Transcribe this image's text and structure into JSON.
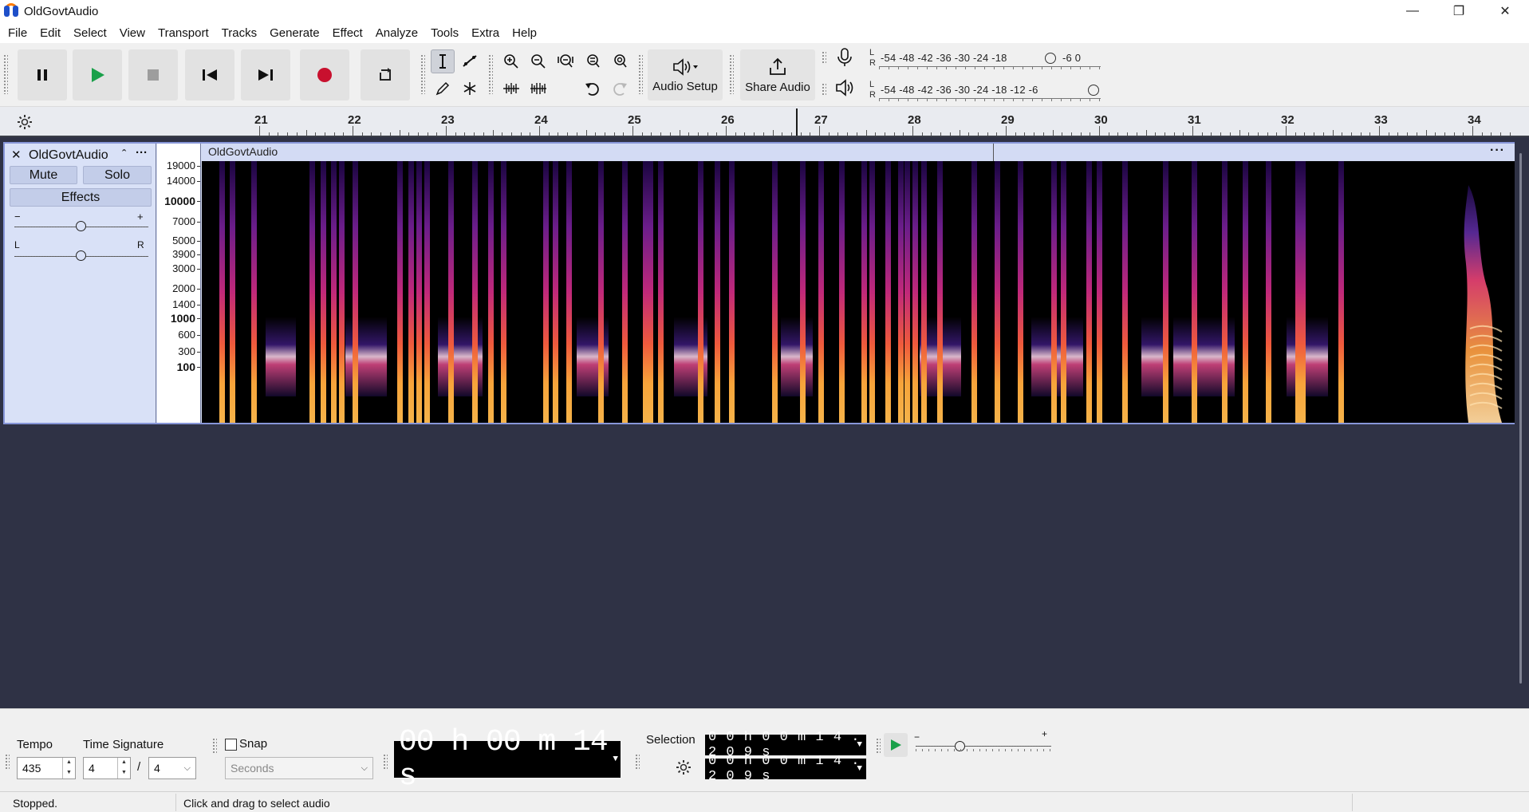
{
  "window": {
    "title": "OldGovtAudio",
    "minimize_glyph": "—",
    "maximize_glyph": "❐",
    "close_glyph": "✕"
  },
  "menu": [
    "File",
    "Edit",
    "Select",
    "View",
    "Transport",
    "Tracks",
    "Generate",
    "Effect",
    "Analyze",
    "Tools",
    "Extra",
    "Help"
  ],
  "toolbar": {
    "transport_icons": [
      "pause-icon",
      "play-icon",
      "stop-icon",
      "skip-to-start-icon",
      "skip-to-end-icon",
      "record-icon",
      "loop-icon"
    ],
    "audio_setup_label": "Audio Setup",
    "share_audio_label": "Share Audio",
    "record_meter": {
      "channels": "L\nR",
      "scale": "-54  -48  -42  -36  -30  -24  -18",
      "end": "-6    0"
    },
    "playback_meter": {
      "channels": "L\nR",
      "scale": "-54  -48  -42  -36  -30  -24  -18  -12   -6"
    }
  },
  "ruler": {
    "labels": [
      "21",
      "22",
      "23",
      "24",
      "25",
      "26",
      "27",
      "28",
      "29",
      "30",
      "31",
      "32",
      "33",
      "34"
    ]
  },
  "track": {
    "name": "OldGovtAudio",
    "close_glyph": "✕",
    "collapse_glyph": "ˆ",
    "menu_glyph": "···",
    "mute_label": "Mute",
    "solo_label": "Solo",
    "effects_label": "Effects",
    "gain_minus": "−",
    "gain_plus": "+",
    "pan_left": "L",
    "pan_right": "R",
    "gain_level": 0.5,
    "pan_level": 0.5,
    "clip_name": "OldGovtAudio",
    "clip_menu_glyph": "···",
    "freq_labels": [
      "19000",
      "14000",
      "10000",
      "7000",
      "5000",
      "3900",
      "3000",
      "2000",
      "1400",
      "1000",
      "600",
      "300",
      "100"
    ],
    "freq_bold": [
      "10000",
      "1000",
      "100"
    ]
  },
  "bottom": {
    "tempo_label": "Tempo",
    "tempo_value": "435",
    "time_sig_label": "Time Signature",
    "time_sig_num": "4",
    "time_sig_slash": "/",
    "time_sig_den": "4",
    "snap_label": "Snap",
    "snap_checked": false,
    "snap_unit": "Seconds",
    "time_display": "00 h 00 m 14 s",
    "selection_label": "Selection",
    "selection_start": "0 0 h 0 0 m 1 4 . 2 0 9 s",
    "selection_end": "0 0 h 0 0 m 1 4 . 2 0 9 s",
    "play_at_speed_minus": "−",
    "play_at_speed_plus": "+",
    "play_at_speed_level": 0.33
  },
  "status": {
    "state": "Stopped.",
    "hint": "Click and drag to select audio"
  }
}
